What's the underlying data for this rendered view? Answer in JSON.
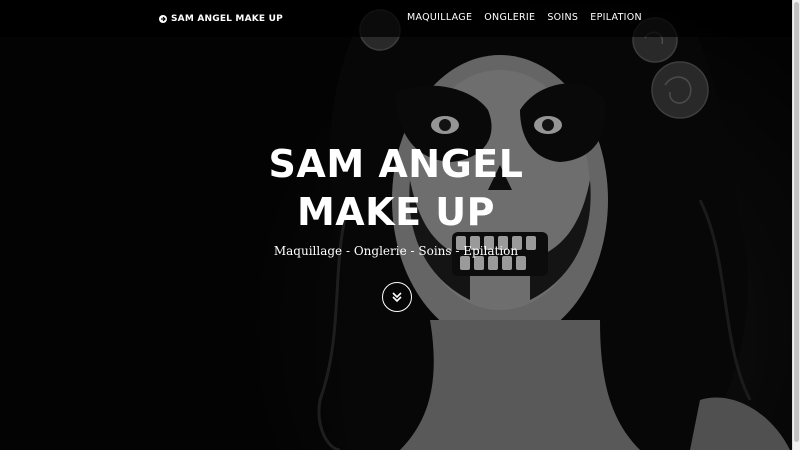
{
  "brand": {
    "name": "SAM ANGEL MAKE UP",
    "icon": "circle-arrow-icon"
  },
  "nav": {
    "items": [
      {
        "label": "MAQUILLAGE"
      },
      {
        "label": "ONGLERIE"
      },
      {
        "label": "SOINS"
      },
      {
        "label": "EPILATION"
      }
    ]
  },
  "hero": {
    "title_line1": "SAM ANGEL",
    "title_line2": "MAKE UP",
    "subtitle": "Maquillage - Onglerie - Soins - Epilation",
    "scroll_icon": "double-chevron-down-icon",
    "image": "black-and-white portrait, woman with sugar-skull face makeup and roses in dark wavy hair"
  },
  "colors": {
    "text": "#ffffff",
    "navbar_bg": "rgba(0,0,0,0.72)"
  }
}
